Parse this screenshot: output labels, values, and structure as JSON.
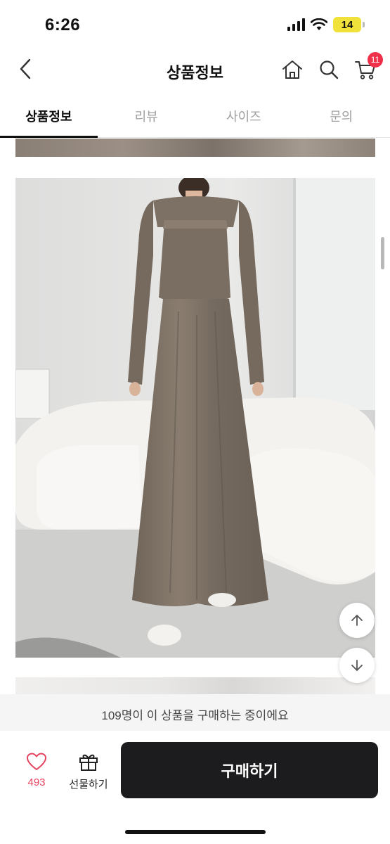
{
  "status_bar": {
    "time": "6:26",
    "battery": "14"
  },
  "nav": {
    "title": "상품정보",
    "cart_count": "11"
  },
  "tabs": [
    {
      "label": "상품정보"
    },
    {
      "label": "리뷰"
    },
    {
      "label": "사이즈"
    },
    {
      "label": "문의"
    }
  ],
  "notice": {
    "text": "109명이 이 상품을 구매하는 중이에요"
  },
  "bottom_bar": {
    "wish_count": "493",
    "gift_label": "선물하기",
    "buy_label": "구매하기"
  },
  "colors": {
    "accent": "#f0304a",
    "buy_button": "#1c1c1e",
    "wish": "#e6435f"
  },
  "icons": [
    "back-chevron-icon",
    "home-icon",
    "search-icon",
    "cart-icon",
    "arrow-up-icon",
    "arrow-down-icon",
    "heart-icon",
    "gift-icon"
  ]
}
